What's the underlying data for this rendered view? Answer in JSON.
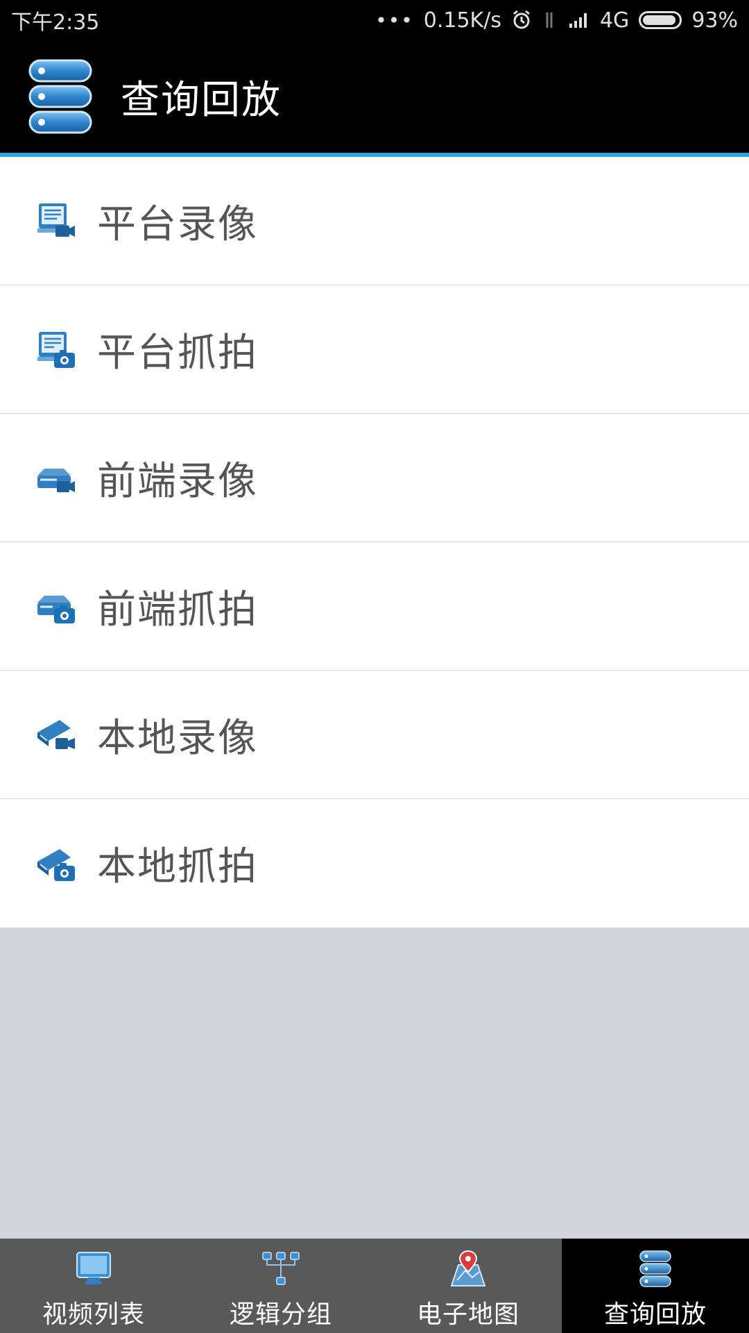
{
  "status_bar": {
    "time": "下午2:35",
    "network_speed": "0.15K/s",
    "network_type": "4G",
    "battery": "93%",
    "battery_level": 0.93
  },
  "app_bar": {
    "title": "查询回放",
    "icon": "server-stack-icon"
  },
  "menu": {
    "items": [
      {
        "label": "平台录像",
        "icon": "platform-record-icon"
      },
      {
        "label": "平台抓拍",
        "icon": "platform-snapshot-icon"
      },
      {
        "label": "前端录像",
        "icon": "frontend-record-icon"
      },
      {
        "label": "前端抓拍",
        "icon": "frontend-snapshot-icon"
      },
      {
        "label": "本地录像",
        "icon": "local-record-icon"
      },
      {
        "label": "本地抓拍",
        "icon": "local-snapshot-icon"
      }
    ]
  },
  "tabs": [
    {
      "label": "视频列表",
      "icon": "monitor-icon",
      "active": false
    },
    {
      "label": "逻辑分组",
      "icon": "group-tree-icon",
      "active": false
    },
    {
      "label": "电子地图",
      "icon": "map-pin-icon",
      "active": false
    },
    {
      "label": "查询回放",
      "icon": "server-stack-icon",
      "active": true
    }
  ],
  "colors": {
    "accent": "#2aa7dd",
    "icon_blue": "#2f7fc1",
    "tab_bg": "#595959",
    "tab_active_bg": "#000000",
    "empty_bg": "#d3d5dd"
  }
}
